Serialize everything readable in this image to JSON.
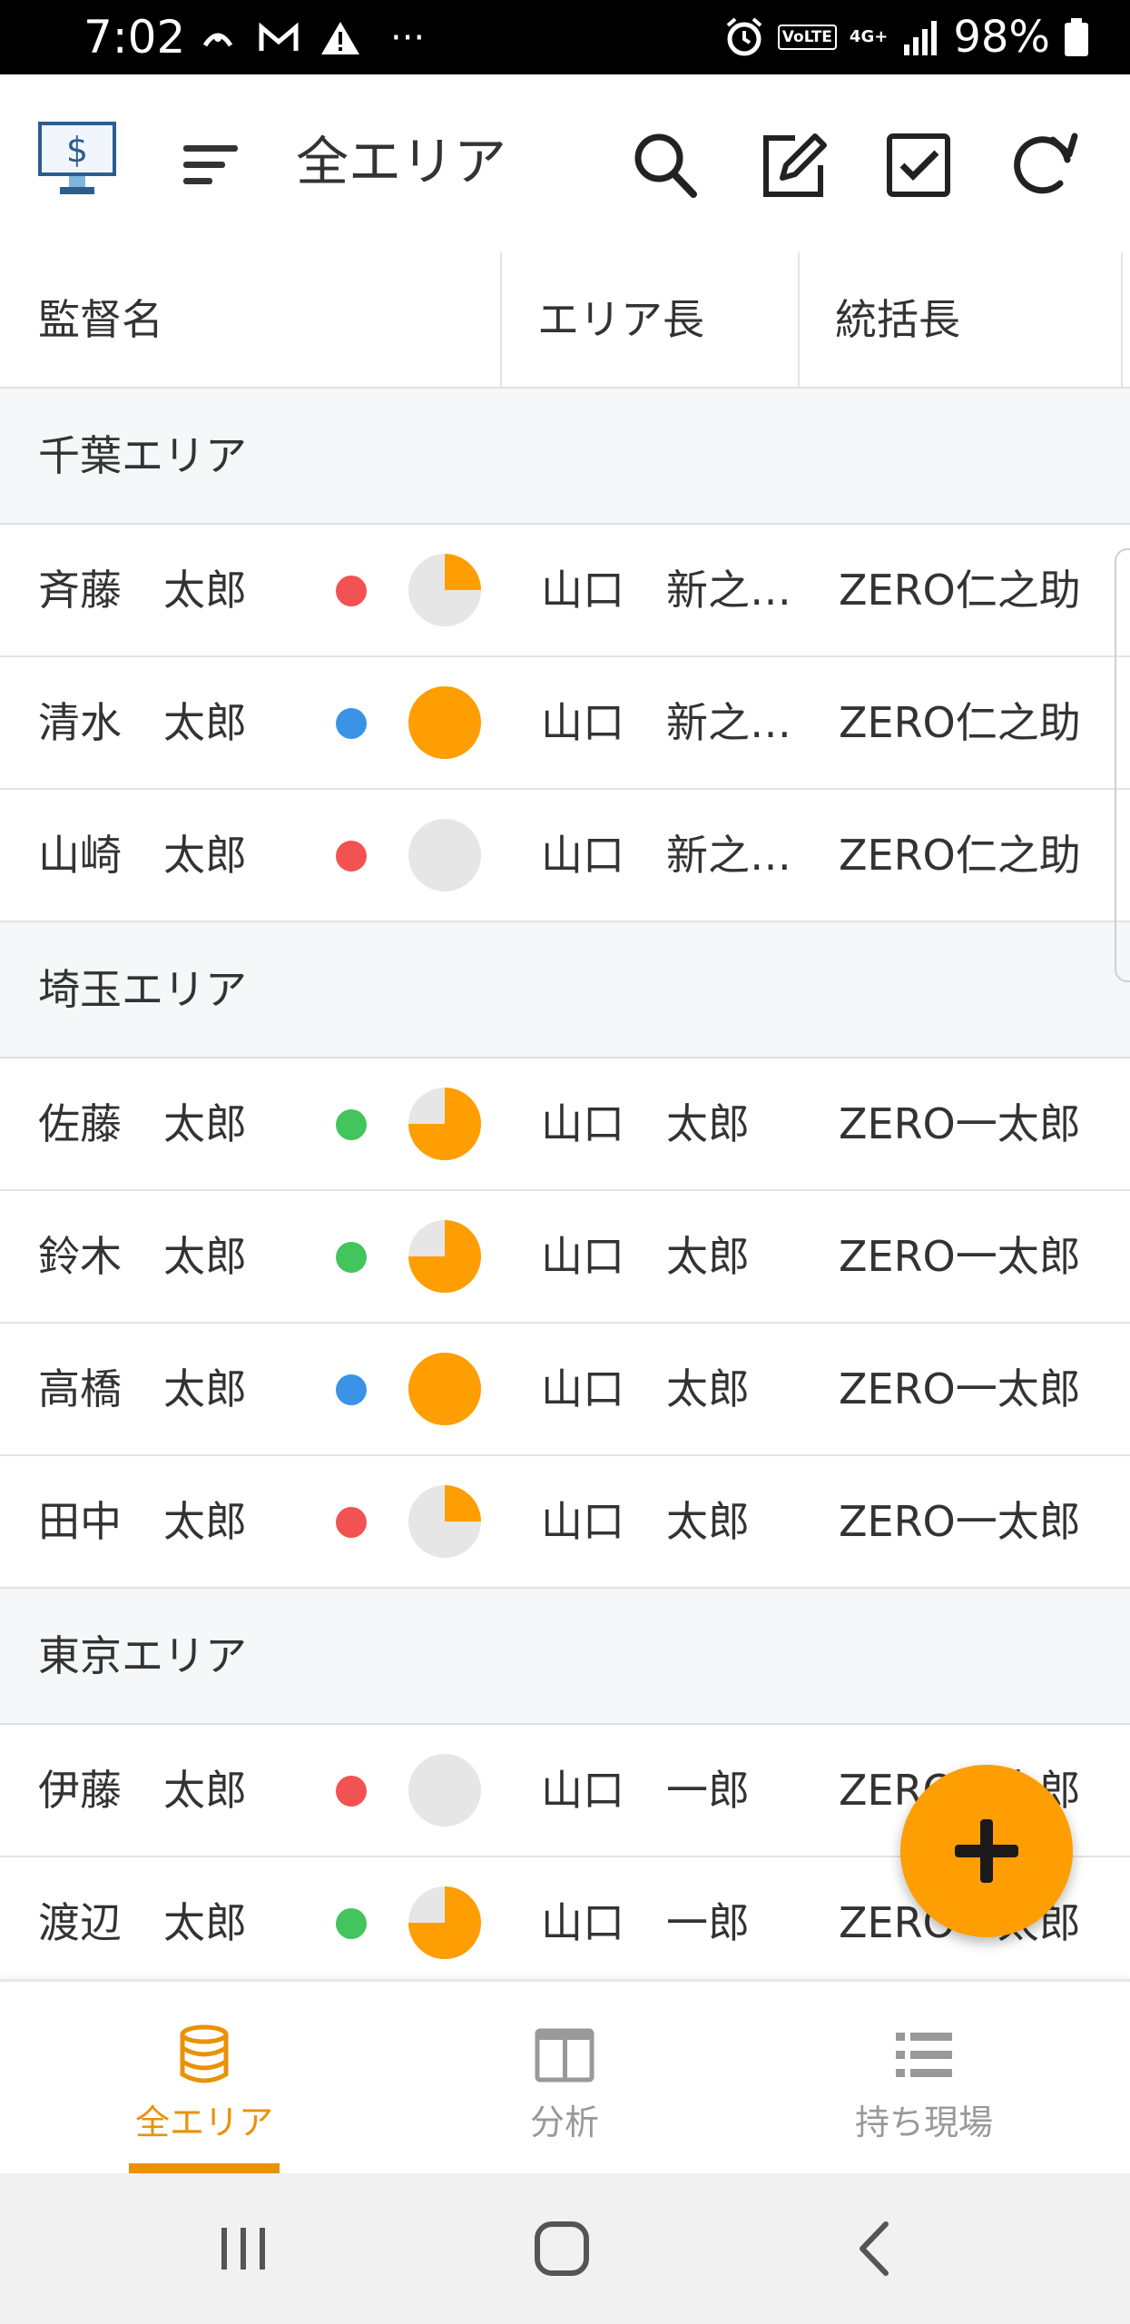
{
  "status_bar": {
    "time": "7:02",
    "battery": "98%",
    "network": "4G+",
    "volte": "VoLTE",
    "ellipsis": "···"
  },
  "app_bar": {
    "title": "全エリア"
  },
  "table": {
    "columns": [
      "監督名",
      "エリア長",
      "統括長"
    ]
  },
  "groups": [
    {
      "name": "千葉エリア",
      "rows": [
        {
          "name": "斉藤　太郎",
          "status_color": "#f25252",
          "progress": 0.25,
          "area_lead": "山口　新之…",
          "chief": "ZERO仁之助"
        },
        {
          "name": "清水　太郎",
          "status_color": "#3b93e8",
          "progress": 1.0,
          "area_lead": "山口　新之…",
          "chief": "ZERO仁之助"
        },
        {
          "name": "山崎　太郎",
          "status_color": "#f25252",
          "progress": 0.0,
          "area_lead": "山口　新之…",
          "chief": "ZERO仁之助"
        }
      ]
    },
    {
      "name": "埼玉エリア",
      "rows": [
        {
          "name": "佐藤　太郎",
          "status_color": "#43c45d",
          "progress": 0.75,
          "area_lead": "山口　太郎",
          "chief": "ZERO一太郎"
        },
        {
          "name": "鈴木　太郎",
          "status_color": "#43c45d",
          "progress": 0.75,
          "area_lead": "山口　太郎",
          "chief": "ZERO一太郎"
        },
        {
          "name": "高橋　太郎",
          "status_color": "#3b93e8",
          "progress": 1.0,
          "area_lead": "山口　太郎",
          "chief": "ZERO一太郎"
        },
        {
          "name": "田中　太郎",
          "status_color": "#f25252",
          "progress": 0.25,
          "area_lead": "山口　太郎",
          "chief": "ZERO一太郎"
        }
      ]
    },
    {
      "name": "東京エリア",
      "rows": [
        {
          "name": "伊藤　太郎",
          "status_color": "#f25252",
          "progress": 0.0,
          "area_lead": "山口　一郎",
          "chief": "ZERO一太郎"
        },
        {
          "name": "渡辺　太郎",
          "status_color": "#43c45d",
          "progress": 0.75,
          "area_lead": "山口　一郎",
          "chief": "ZERO一太郎"
        }
      ]
    }
  ],
  "fab": {
    "icon": "plus-icon"
  },
  "bottom_nav": {
    "items": [
      {
        "label": "全エリア",
        "icon": "database-icon",
        "active": true
      },
      {
        "label": "分析",
        "icon": "columns-icon",
        "active": false
      },
      {
        "label": "持ち現場",
        "icon": "list-icon",
        "active": false
      }
    ]
  },
  "colors": {
    "accent": "#ff9e02",
    "active_nav": "#e99205",
    "inactive_nav": "#999999",
    "pie_empty": "#e6e6e6"
  }
}
